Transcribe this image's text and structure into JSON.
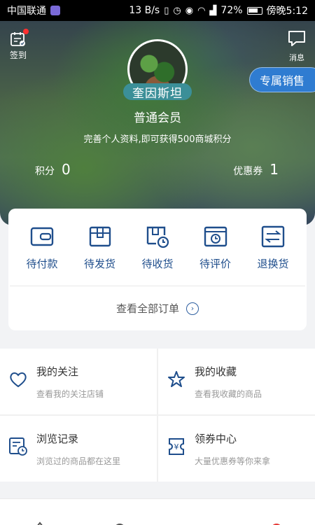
{
  "status_bar": {
    "carrier": "中国联通",
    "speed": "13 B/s",
    "battery": "72%",
    "time": "傍晚5:12"
  },
  "header": {
    "checkin_label": "签到",
    "message_label": "消息",
    "nickname": "奎因斯坦",
    "vip_button": "专属销售",
    "member_level": "普通会员",
    "tip": "完善个人资料,即可获得500商城积分",
    "points_label": "积分",
    "points_value": "0",
    "coupons_label": "优惠券",
    "coupons_value": "1"
  },
  "orders": {
    "items": [
      {
        "label": "待付款",
        "icon": "wallet-icon"
      },
      {
        "label": "待发货",
        "icon": "package-icon"
      },
      {
        "label": "待收货",
        "icon": "delivery-icon"
      },
      {
        "label": "待评价",
        "icon": "review-icon"
      },
      {
        "label": "退换货",
        "icon": "exchange-icon"
      }
    ],
    "view_all": "查看全部订单"
  },
  "features": [
    {
      "title": "我的关注",
      "sub": "查看我的关注店铺",
      "icon": "heart-icon"
    },
    {
      "title": "我的收藏",
      "sub": "查看我收藏的商品",
      "icon": "star-icon"
    },
    {
      "title": "浏览记录",
      "sub": "浏览过的商品都在这里",
      "icon": "history-icon"
    },
    {
      "title": "领券中心",
      "sub": "大量优惠券等你来拿",
      "icon": "coupon-icon"
    }
  ],
  "colors": {
    "accent_blue": "#2f7cd1",
    "icon_blue": "#1f4e8c",
    "badge_red": "#ff3030"
  }
}
